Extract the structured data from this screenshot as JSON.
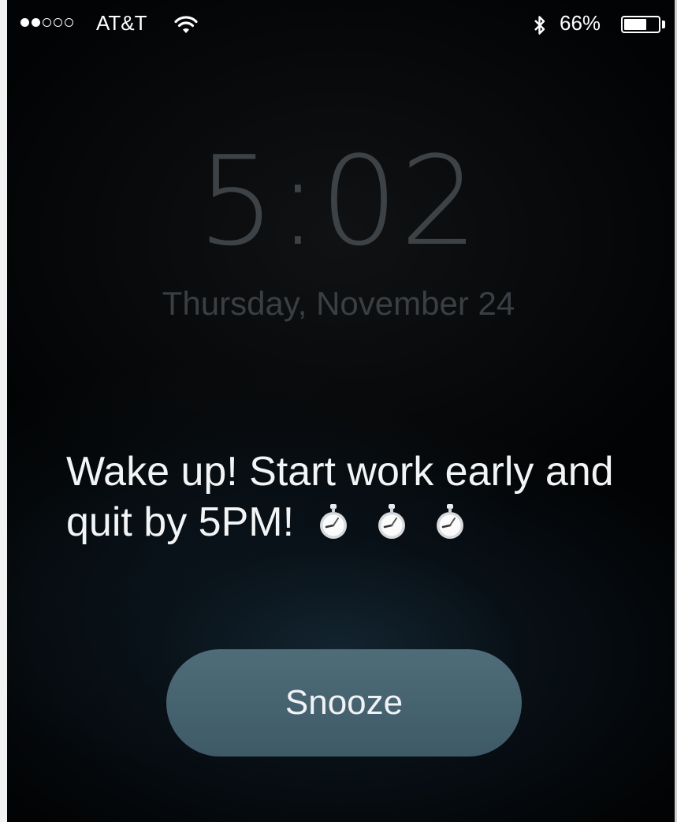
{
  "status_bar": {
    "signal_bars_filled": 2,
    "signal_bars_total": 5,
    "carrier": "AT&T",
    "wifi_icon": "wifi-icon",
    "bluetooth_icon": "bluetooth-icon",
    "battery_percent": "66%",
    "battery_level": 0.66
  },
  "lock_screen": {
    "time": "5:02",
    "date": "Thursday, November 24"
  },
  "alarm": {
    "message": "Wake up! Start work early and quit by 5PM!",
    "emoji_icons": [
      "stopwatch-icon",
      "stopwatch-icon",
      "stopwatch-icon"
    ],
    "snooze_label": "Snooze"
  },
  "colors": {
    "snooze_button": "#4a6573",
    "time_text": "#3c4246",
    "message_text": "#f2f4f5"
  }
}
